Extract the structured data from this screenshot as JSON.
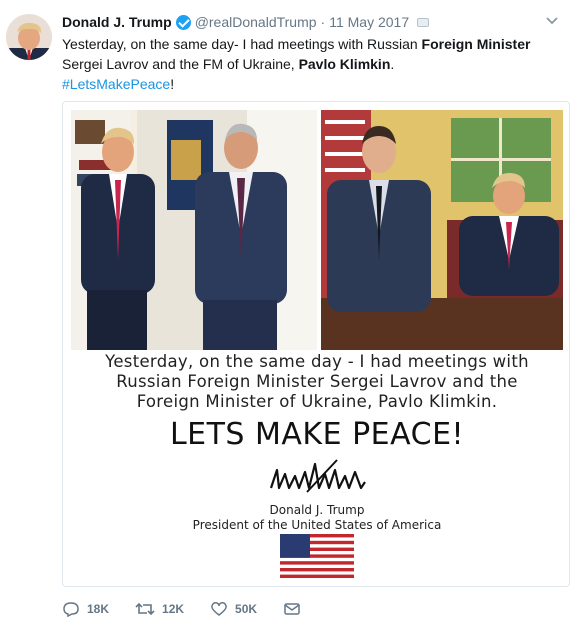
{
  "tweet": {
    "author_name": "Donald J. Trump",
    "handle": "@realDonaldTrump",
    "separator": "·",
    "date": "11 May 2017",
    "body": {
      "part1": "Yesterday, on the same day- I had meetings with Russian ",
      "bold1": "Foreign Minister",
      "part2": " Sergei Lavrov and the FM of Ukraine, ",
      "bold2": "Pavlo Klimkin",
      "part3": ".",
      "hashtag": "#LetsMakePeace",
      "end": "!"
    },
    "menu_icon": "chevron-down-icon"
  },
  "image": {
    "caption_line1": "Yesterday, on the same day - I had meetings with",
    "caption_line2": "Russian Foreign Minister Sergei Lavrov and the",
    "caption_line3": "Foreign Minister of Ukraine, Pavlo Klimkin.",
    "slogan": "LETS MAKE PEACE!",
    "signer_name": "Donald J. Trump",
    "signer_title": "President of the United States of America"
  },
  "actions": {
    "replies": "18K",
    "retweets": "12K",
    "likes": "50K",
    "icons": [
      "reply-icon",
      "retweet-icon",
      "heart-icon",
      "message-icon"
    ]
  },
  "colors": {
    "verified": "#1da1f2",
    "link": "#1b95e0",
    "muted": "#657786",
    "border": "#e1e8ed"
  }
}
